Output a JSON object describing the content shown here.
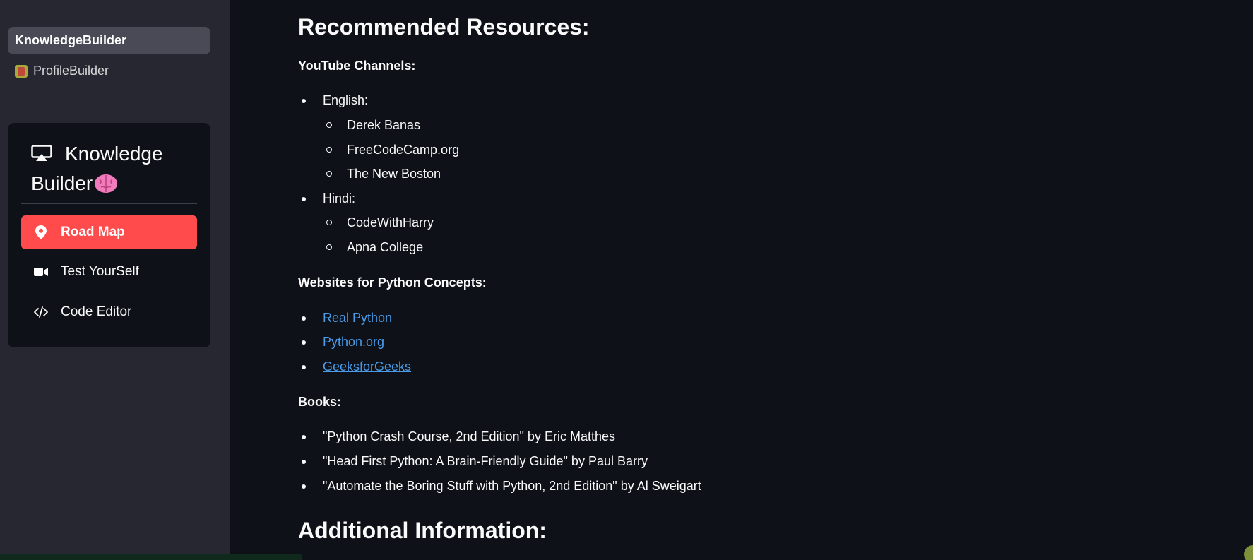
{
  "sidebar": {
    "pages": [
      {
        "label": "KnowledgeBuilder"
      },
      {
        "label": "ProfileBuilder",
        "icon": "trophy-emoji-icon"
      }
    ],
    "menu": {
      "title_line1": "Knowledge",
      "title_line2": "Builder",
      "title_icon": "airplay-icon",
      "title_emoji": "brain-emoji-icon",
      "items": [
        {
          "label": "Road Map",
          "icon": "map-pin-icon",
          "selected": true
        },
        {
          "label": "Test YourSelf",
          "icon": "video-camera-icon"
        },
        {
          "label": "Code Editor",
          "icon": "code-icon"
        }
      ]
    }
  },
  "main": {
    "heading": "Recommended Resources:",
    "youtube": {
      "title": "YouTube Channels:",
      "groups": [
        {
          "label": "English:",
          "channels": [
            "Derek Banas",
            "FreeCodeCamp.org",
            "The New Boston"
          ]
        },
        {
          "label": "Hindi:",
          "channels": [
            "CodeWithHarry",
            "Apna College"
          ]
        }
      ]
    },
    "websites": {
      "title": "Websites for Python Concepts:",
      "links": [
        "Real Python",
        "Python.org",
        "GeeksforGeeks"
      ]
    },
    "books": {
      "title": "Books:",
      "items": [
        "\"Python Crash Course, 2nd Edition\" by Eric Matthes",
        "\"Head First Python: A Brain-Friendly Guide\" by Paul Barry",
        "\"Automate the Boring Stuff with Python, 2nd Edition\" by Al Sweigart"
      ]
    },
    "heading2": "Additional Information:"
  },
  "colors": {
    "background": "#0e1117",
    "sidebar": "#262730",
    "accent": "#ff4b4b",
    "link": "#4a9be8"
  }
}
